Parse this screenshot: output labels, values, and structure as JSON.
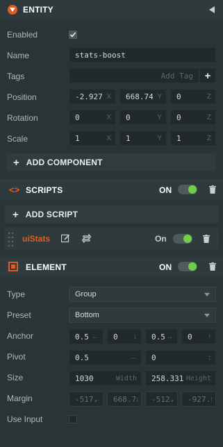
{
  "entity": {
    "title": "ENTITY",
    "enabled_label": "Enabled",
    "enabled": true,
    "name_label": "Name",
    "name_value": "stats-boost",
    "tags_label": "Tags",
    "tags_placeholder": "Add Tag",
    "position_label": "Position",
    "position": [
      "-2.927",
      "668.74",
      "0"
    ],
    "rotation_label": "Rotation",
    "rotation": [
      "0",
      "0",
      "0"
    ],
    "scale_label": "Scale",
    "scale": [
      "1",
      "1",
      "1"
    ],
    "axis_x": "X",
    "axis_y": "Y",
    "axis_z": "Z",
    "add_component_label": "ADD COMPONENT"
  },
  "scripts": {
    "title": "SCRIPTS",
    "on_label": "ON",
    "add_script_label": "ADD SCRIPT",
    "script_name": "uiStats",
    "script_on_label": "On"
  },
  "element": {
    "title": "ELEMENT",
    "on_label": "ON",
    "type_label": "Type",
    "type_value": "Group",
    "preset_label": "Preset",
    "preset_value": "Bottom",
    "anchor_label": "Anchor",
    "anchor": [
      "0.5",
      "0",
      "0.5",
      "0"
    ],
    "anchor_suffix": [
      "←",
      "↓",
      "→",
      "↑"
    ],
    "pivot_label": "Pivot",
    "pivot": [
      "0.5",
      "0"
    ],
    "pivot_suffix": [
      "↔",
      "↕"
    ],
    "size_label": "Size",
    "width_value": "1030",
    "width_suffix": "Width",
    "height_value": "258.331",
    "height_suffix": "Height",
    "margin_label": "Margin",
    "margin": [
      "-517.",
      "668.7",
      "-512.",
      "-927."
    ],
    "margin_suffix": [
      "←",
      "↓",
      "→",
      "↑"
    ],
    "use_input_label": "Use Input"
  },
  "colors": {
    "accent": "#e05c24",
    "toggle_on": "#6fce4a",
    "panel_bg": "#2a3436",
    "header_bg": "#2f3a3c"
  }
}
